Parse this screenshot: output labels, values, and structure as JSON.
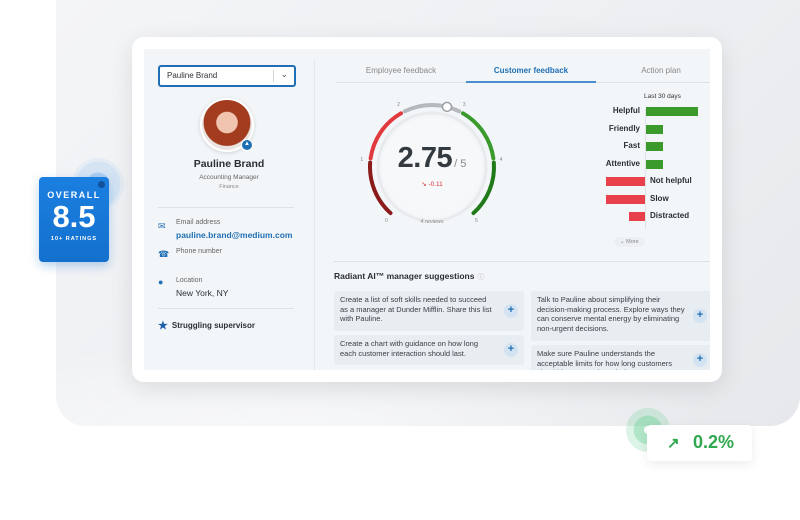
{
  "employee_selector": {
    "value": "Pauline Brand"
  },
  "profile": {
    "name": "Pauline Brand",
    "role": "Accounting Manager",
    "department": "Finance",
    "email_label": "Email address",
    "email": "pauline.brand@medium.com",
    "phone_label": "Phone number",
    "phone": "",
    "location_label": "Location",
    "location": "New York, NY",
    "tag": "Struggling supervisor"
  },
  "tabs": [
    {
      "label": "Employee feedback",
      "active": false
    },
    {
      "label": "Customer feedback",
      "active": true
    },
    {
      "label": "Action plan",
      "active": false
    }
  ],
  "gauge": {
    "score": "2.75",
    "out_of": "/ 5",
    "score_value": 2.75,
    "max": 5,
    "delta": "-0.11",
    "reviews": "4 reviews",
    "ticks": [
      "0",
      "1",
      "2",
      "3",
      "4",
      "5"
    ],
    "colors": {
      "dark_red": "#8b1a1a",
      "red": "#e0393e",
      "neutral": "#b5b9bd",
      "green": "#3a9a2c",
      "dark_green": "#217a1a"
    }
  },
  "chart_data": {
    "type": "bar",
    "title": "Last 30 days",
    "orientation": "diverging-horizontal",
    "categories": [
      "Helpful",
      "Friendly",
      "Fast",
      "Attentive",
      "Not helpful",
      "Slow",
      "Distracted"
    ],
    "values": [
      4,
      1.3,
      1.3,
      1.3,
      -3,
      -3,
      -1.2
    ],
    "colors": {
      "positive": "#3a9a2c",
      "negative": "#e8414b"
    },
    "more_label": "More"
  },
  "suggestions": {
    "title": "Radiant AI™ manager suggestions",
    "info_icon": "info-icon",
    "items": [
      "Create a list of soft skills needed to succeed as a manager at Dunder Mifflin. Share this list with Pauline.",
      "Create a chart with guidance on how long each customer interaction should last.",
      "Talk to Pauline about simplifying their decision-making process. Explore ways they can conserve mental energy by eliminating non-urgent decisions.",
      "Make sure Pauline understands the acceptable limits for how long customers should have to wait on their responses."
    ],
    "add_label": "+"
  },
  "overall_badge": {
    "label": "OVERALL",
    "value": "8.5",
    "sub": "10+ RATINGS",
    "color": "#1877d9"
  },
  "growth_badge": {
    "value": "0.2%",
    "icon": "trending-up-icon",
    "color": "#2fa84f"
  }
}
